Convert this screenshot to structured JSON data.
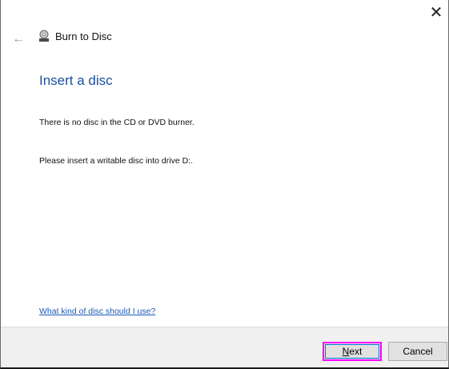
{
  "window": {
    "title": "Burn to Disc"
  },
  "page": {
    "heading": "Insert a disc",
    "message1": "There is no disc in the CD or DVD burner.",
    "message2": "Please insert a writable disc into drive D:.",
    "help_link": "What kind of disc should I use?"
  },
  "buttons": {
    "next_mnemonic": "N",
    "next_rest": "ext",
    "cancel": "Cancel"
  },
  "icons": {
    "back": "back-arrow-icon",
    "close": "close-icon",
    "app": "disc-burner-icon"
  },
  "colors": {
    "heading": "#1a4f9c",
    "link": "#1a5ab8",
    "highlight": "#ff00ff"
  }
}
